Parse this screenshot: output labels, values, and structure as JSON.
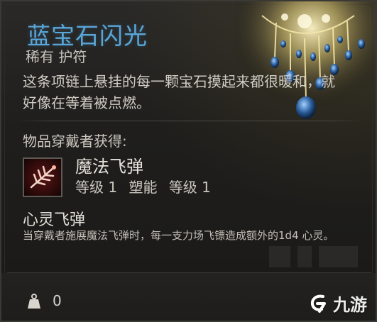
{
  "item": {
    "name": "蓝宝石闪光",
    "rarity_type": "稀有 护符",
    "description": "这条项链上悬挂的每一颗宝石摸起来都很暖和，就好像在等着被点燃。",
    "grants_label": "物品穿戴者获得:"
  },
  "spell": {
    "icon": "magic-missile-icon",
    "name": "魔法飞弹",
    "level_label": "等级 1",
    "school": "塑能",
    "rank_label": "等级 1"
  },
  "passive": {
    "name": "心灵飞弹",
    "description": "当穿戴者施展魔法飞弹时，每一支力场飞镖造成额外的1d4 心灵。"
  },
  "footer": {
    "weight_icon": "weight-icon",
    "weight_value": "0"
  },
  "watermark": {
    "text": "九游"
  },
  "colors": {
    "title": "#5aa6d8",
    "background": "#1f1e1c",
    "text": "#cfccc4"
  }
}
